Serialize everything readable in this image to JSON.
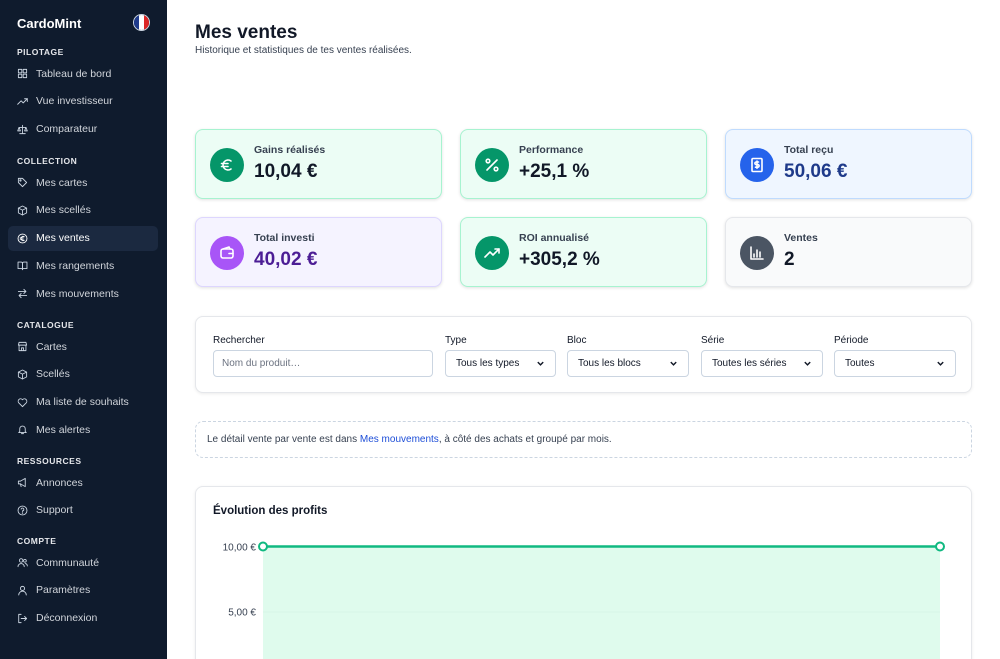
{
  "app": {
    "name": "CardoMint"
  },
  "sidebar": {
    "sections": [
      {
        "title": "PILOTAGE",
        "items": [
          {
            "label": "Tableau de bord",
            "icon": "dashboard-icon"
          },
          {
            "label": "Vue investisseur",
            "icon": "trending-up-icon"
          },
          {
            "label": "Comparateur",
            "icon": "scale-icon"
          }
        ]
      },
      {
        "title": "COLLECTION",
        "items": [
          {
            "label": "Mes cartes",
            "icon": "tag-icon"
          },
          {
            "label": "Mes scellés",
            "icon": "box-icon"
          },
          {
            "label": "Mes ventes",
            "icon": "euro-circle-icon",
            "active": true
          },
          {
            "label": "Mes rangements",
            "icon": "book-icon"
          },
          {
            "label": "Mes mouvements",
            "icon": "arrows-icon"
          }
        ]
      },
      {
        "title": "CATALOGUE",
        "items": [
          {
            "label": "Cartes",
            "icon": "store-icon"
          },
          {
            "label": "Scellés",
            "icon": "box-icon"
          },
          {
            "label": "Ma liste de souhaits",
            "icon": "heart-icon"
          },
          {
            "label": "Mes alertes",
            "icon": "bell-icon"
          }
        ]
      },
      {
        "title": "RESSOURCES",
        "items": [
          {
            "label": "Annonces",
            "icon": "megaphone-icon"
          },
          {
            "label": "Support",
            "icon": "help-icon"
          }
        ]
      },
      {
        "title": "COMPTE",
        "items": [
          {
            "label": "Communauté",
            "icon": "users-icon"
          },
          {
            "label": "Paramètres",
            "icon": "user-icon"
          },
          {
            "label": "Déconnexion",
            "icon": "logout-icon"
          }
        ]
      }
    ]
  },
  "header": {
    "title": "Mes ventes",
    "subtitle": "Historique et statistiques de tes ventes réalisées."
  },
  "stats": [
    {
      "label": "Gains réalisés",
      "value": "10,04 €",
      "icon": "euro-icon",
      "accent": "#059669",
      "bg": "#ecfdf5",
      "border": "#a7f3d0",
      "color": "#111827"
    },
    {
      "label": "Performance",
      "value": "+25,1 %",
      "icon": "percent-icon",
      "accent": "#059669",
      "bg": "#ecfdf5",
      "border": "#a7f3d0",
      "color": "#111827"
    },
    {
      "label": "Total reçu",
      "value": "50,06 €",
      "icon": "receipt-icon",
      "accent": "#2563eb",
      "bg": "#eff6ff",
      "border": "#bfdbfe",
      "color": "#1e3a8a"
    },
    {
      "label": "Total investi",
      "value": "40,02 €",
      "icon": "wallet-icon",
      "accent": "#a855f7",
      "bg": "#f5f3ff",
      "border": "#ddd6fe",
      "color": "#4c1d95"
    },
    {
      "label": "ROI annualisé",
      "value": "+305,2 %",
      "icon": "trending-up-icon",
      "accent": "#059669",
      "bg": "#ecfdf5",
      "border": "#a7f3d0",
      "color": "#111827"
    },
    {
      "label": "Ventes",
      "value": "2",
      "icon": "bar-chart-icon",
      "accent": "#4b5563",
      "bg": "#f9fafb",
      "border": "#e5e7eb",
      "color": "#111827"
    }
  ],
  "filters": {
    "search": {
      "label": "Rechercher",
      "placeholder": "Nom du produit…"
    },
    "type": {
      "label": "Type",
      "value": "Tous les types"
    },
    "bloc": {
      "label": "Bloc",
      "value": "Tous les blocs"
    },
    "serie": {
      "label": "Série",
      "value": "Toutes les séries"
    },
    "periode": {
      "label": "Période",
      "value": "Toutes"
    }
  },
  "info": {
    "before": "Le détail vente par vente est dans ",
    "link": "Mes mouvements",
    "after": ", à côté des achats et groupé par mois."
  },
  "chart_data": {
    "type": "area",
    "title": "Évolution des profits",
    "y_ticks": [
      "10,00 €",
      "5,00 €"
    ],
    "ylim": [
      0,
      10
    ],
    "series": [
      {
        "values": [
          10.04,
          10.04
        ]
      }
    ],
    "colors": {
      "line": "#10b981",
      "fill": "#d1fae5"
    }
  }
}
